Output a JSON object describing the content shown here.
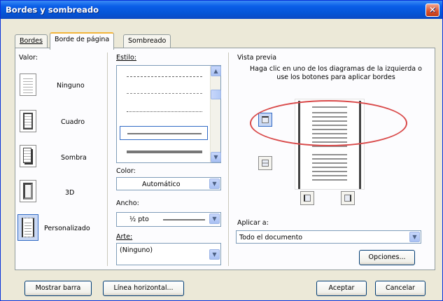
{
  "window": {
    "title": "Bordes y sombreado",
    "close_glyph": "✕"
  },
  "tabs": [
    {
      "label": "Bordes",
      "active": false
    },
    {
      "label": "Borde de página",
      "active": true
    },
    {
      "label": "Sombreado",
      "active": false
    }
  ],
  "setting": {
    "label": "Valor:",
    "options": [
      {
        "label": "Ninguno",
        "icon": "border-none-icon"
      },
      {
        "label": "Cuadro",
        "icon": "border-box-icon"
      },
      {
        "label": "Sombra",
        "icon": "border-shadow-icon"
      },
      {
        "label": "3D",
        "icon": "border-3d-icon"
      },
      {
        "label": "Personalizado",
        "icon": "border-custom-icon",
        "selected": true
      }
    ]
  },
  "style": {
    "label": "Estilo:",
    "scroll_up": "▲",
    "scroll_down": "▼"
  },
  "color": {
    "label": "Color:",
    "value": "Automático"
  },
  "width": {
    "label": "Ancho:",
    "value": "½ pto"
  },
  "art": {
    "label": "Arte:",
    "value": "(Ninguno)"
  },
  "preview": {
    "label": "Vista previa",
    "hint": "Haga clic en uno de los diagramas de la izquierda o use los botones para aplicar bordes"
  },
  "apply_to": {
    "label": "Aplicar a:",
    "value": "Todo el documento"
  },
  "combo_arrow": "▼",
  "buttons": {
    "options": "Opciones...",
    "show_toolbar": "Mostrar barra",
    "horizontal_line": "Línea horizontal...",
    "ok": "Aceptar",
    "cancel": "Cancelar"
  },
  "colors": {
    "title_bar": "#0454d6",
    "dialog_bg": "#ece9d8",
    "annotation": "#d94a4a"
  }
}
